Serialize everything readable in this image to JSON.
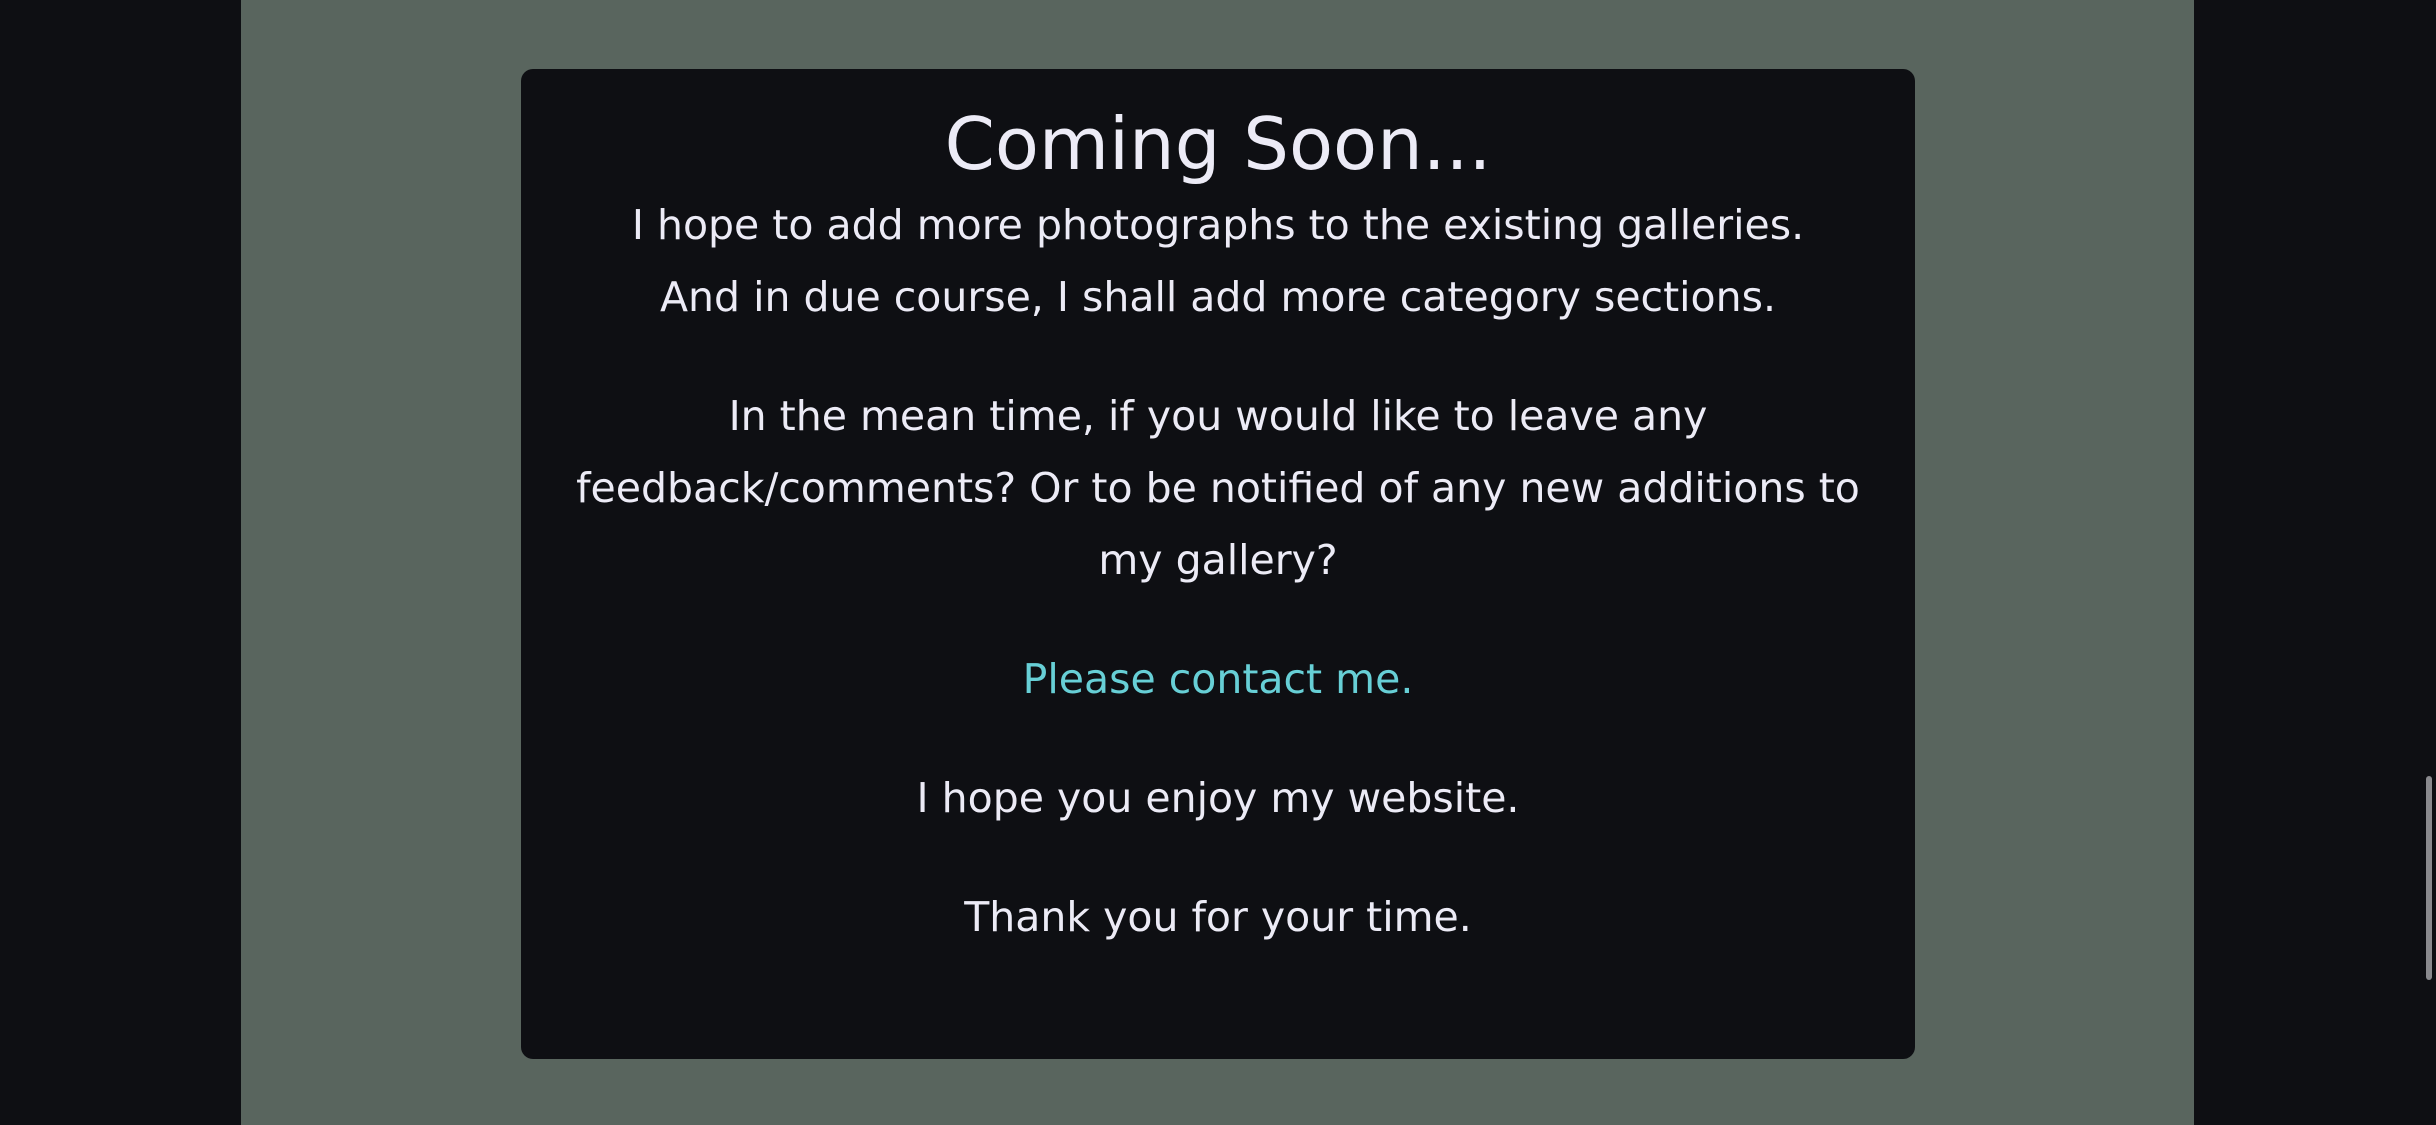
{
  "card": {
    "heading": "Coming Soon...",
    "paragraph_1": "I hope to add more photographs to the existing galleries. And in due course, I shall add more category sections.",
    "paragraph_2": "In the mean time, if you would like to leave any feedback/comments? Or to be notified of any new additions to my gallery?",
    "contact_link": "Please contact me.",
    "paragraph_3": "I hope you enjoy my website.",
    "paragraph_4": "Thank you for your time."
  },
  "colors": {
    "page_background": "#0e0f13",
    "column_background": "#59655e",
    "card_background": "#0e0f13",
    "text": "#ecebf6",
    "link": "#67cfd6"
  }
}
